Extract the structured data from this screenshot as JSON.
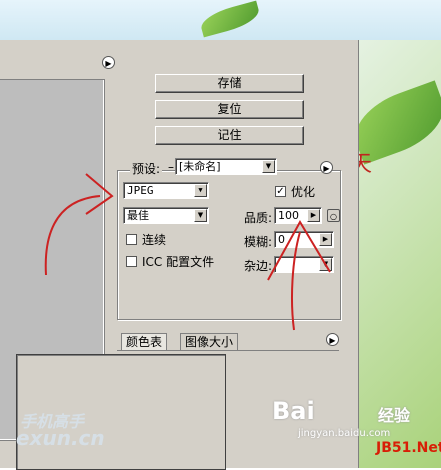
{
  "buttons": {
    "save": "存储",
    "reset": "复位",
    "remember": "记住"
  },
  "preset": {
    "label": "预设:",
    "value": "[未命名]"
  },
  "format": {
    "value": "JPEG"
  },
  "quality_level": {
    "value": "最佳"
  },
  "optimize": {
    "label": "优化",
    "checked": true
  },
  "quality": {
    "label": "品质:",
    "value": "100"
  },
  "blur": {
    "label": "模糊:",
    "value": "0"
  },
  "matte": {
    "label": "杂边:"
  },
  "progressive": {
    "label": "连续",
    "checked": false
  },
  "icc": {
    "label": "ICC 配置文件",
    "checked": false
  },
  "tabs": [
    "颜色表",
    "图像大小"
  ],
  "background_text": "天",
  "watermarks": {
    "left_top": "手机高手",
    "left_bottom": "exun.cn",
    "baidu": "Bai",
    "jingyan": "经验",
    "jingyan_url": "jingyan.baidu.com",
    "jb51": "JB51.Net"
  },
  "colors": {
    "dialog_bg": "#d4d0c8",
    "annotation": "#cc2222"
  }
}
